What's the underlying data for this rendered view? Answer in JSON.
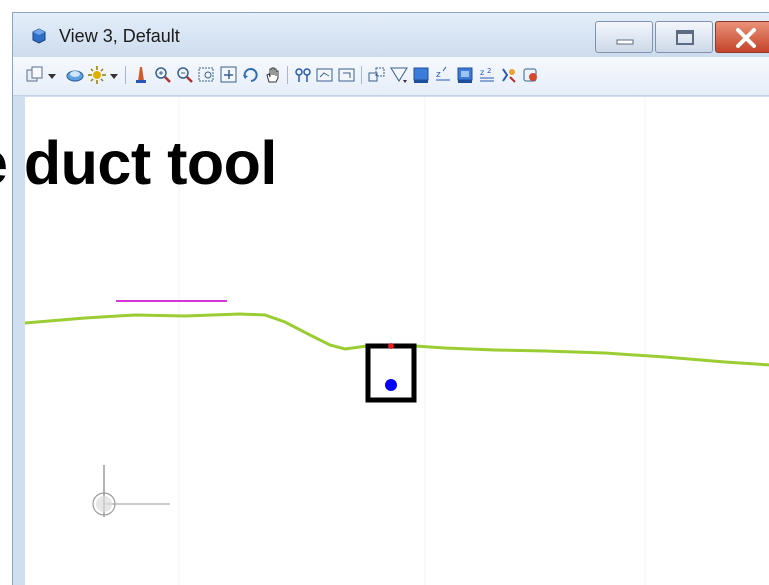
{
  "window": {
    "title": "View 3, Default",
    "controls": {
      "minimize_icon": "minimize-icon",
      "maximize_icon": "maximize-icon",
      "close_icon": "close-icon"
    }
  },
  "toolbar": {
    "tools": [
      "view-display-icon",
      "level-display-icon",
      "view-attributes-icon",
      "update-view-icon",
      "zoom-in-icon",
      "zoom-out-icon",
      "window-area-icon",
      "fit-view-icon",
      "rotate-view-icon",
      "pan-view-icon",
      "view-previous-icon",
      "view-next-icon",
      "copy-view-icon",
      "clip-volume-icon",
      "clip-mask-icon",
      "display-style-icon",
      "camera-icon",
      "view-properties-icon",
      "rendering-icon"
    ]
  },
  "overlay": {
    "text": "e duct tool"
  },
  "drawing": {
    "ground_line_color": "#9acd32",
    "marker_line_color": "#d11ad1",
    "duct_outline_color": "#000000",
    "duct_point_color": "#0000ff",
    "duct_top_point_color": "#e02020",
    "axis_color": "#9a9a9a"
  }
}
